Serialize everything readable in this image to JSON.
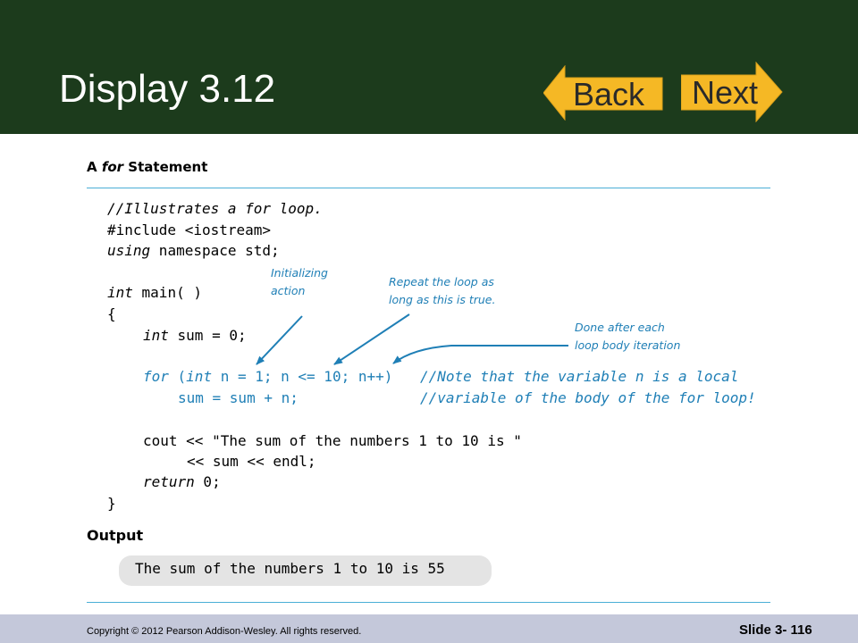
{
  "slide": {
    "title": "Display 3.12",
    "back_label": "Back",
    "next_label": "Next",
    "heading_prefix": "A ",
    "heading_keyword": "for",
    "heading_suffix": " Statement",
    "output_heading": "Output",
    "copyright": "Copyright © 2012 Pearson Addison-Wesley.  All rights reserved.",
    "slide_number": "Slide 3- 116"
  },
  "code": {
    "comment": "//Illustrates a for loop.",
    "include": "#include <iostream>",
    "using_kw": "using",
    "using_rest": " namespace std;",
    "main_kw": "int",
    "main_rest": " main( )",
    "open_brace": "{",
    "decl_kw": "int",
    "decl_rest": " sum = 0;",
    "for_kw": "for",
    "for_open": " (",
    "for_int_kw": "int",
    "for_rest": " n = 1; n <= 10; n++)",
    "body": "sum = sum + n;",
    "note_line1": "//Note that the variable n is a local",
    "note_line2": "//variable of the body of the for loop!",
    "cout_line1": "cout << \"The sum of the numbers 1 to 10 is \"",
    "cout_line2": "<< sum << endl;",
    "return_kw": "return",
    "return_rest": " 0;",
    "close_brace": "}"
  },
  "annotations": {
    "initializing_line1": "Initializing",
    "initializing_line2": "action",
    "repeat_line1": "Repeat the loop as",
    "repeat_line2": "long as this is true.",
    "done_line1": "Done after each",
    "done_line2": "loop body iteration"
  },
  "output": {
    "text": "The sum of the numbers 1 to 10 is 55"
  },
  "colors": {
    "header_bg": "#1c3b1c",
    "nav_button": "#f5b825",
    "annotation": "#1f7fb6",
    "rule": "#4aaed6",
    "footer_bg": "#c4c8da"
  }
}
